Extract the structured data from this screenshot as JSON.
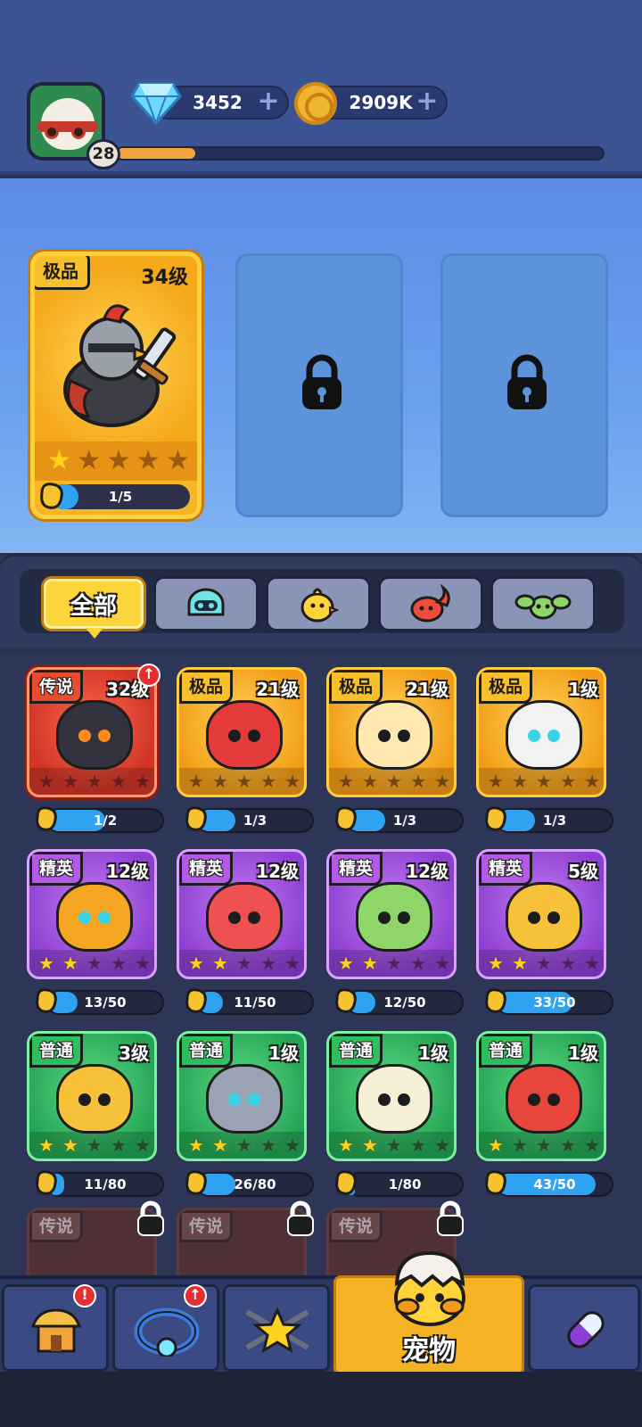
{
  "player": {
    "level": "28",
    "xp_fraction": 0.16
  },
  "currencies": {
    "gems": {
      "value": "3452",
      "plus": "+",
      "icon": "gem-icon"
    },
    "coins": {
      "value": "2909K",
      "plus": "+",
      "icon": "coin-icon"
    }
  },
  "featured": {
    "rarity": "极品",
    "level": "34级",
    "stars_on": 1,
    "stars_total": 5,
    "progress_text": "1/5",
    "progress_fraction": 0.2,
    "locked_slots": 2
  },
  "tabs": [
    {
      "label": "全部",
      "active": true,
      "icon": "all-text"
    },
    {
      "label": "",
      "active": false,
      "icon": "robot-icon"
    },
    {
      "label": "",
      "active": false,
      "icon": "chick-icon"
    },
    {
      "label": "",
      "active": false,
      "icon": "fire-blob-icon"
    },
    {
      "label": "",
      "active": false,
      "icon": "plant-icon"
    }
  ],
  "pets": [
    {
      "rarity": "传说",
      "tier": "legend",
      "level": "32级",
      "stars": 0,
      "progress": "1/2",
      "fraction": 0.5,
      "upgrade": true,
      "color": "#333340",
      "eye": "#ff8a1a"
    },
    {
      "rarity": "极品",
      "tier": "epic",
      "level": "21级",
      "stars": 0,
      "progress": "1/3",
      "fraction": 0.33,
      "upgrade": false,
      "color": "#e53b3b",
      "eye": "#1d1d1d"
    },
    {
      "rarity": "极品",
      "tier": "epic",
      "level": "21级",
      "stars": 0,
      "progress": "1/3",
      "fraction": 0.33,
      "upgrade": false,
      "color": "#ffe9b0",
      "eye": "#1d1d1d"
    },
    {
      "rarity": "极品",
      "tier": "epic",
      "level": "1级",
      "stars": 0,
      "progress": "1/3",
      "fraction": 0.33,
      "upgrade": false,
      "color": "#f2f2f2",
      "eye": "#38d3e6"
    },
    {
      "rarity": "精英",
      "tier": "elite",
      "level": "12级",
      "stars": 2,
      "progress": "13/50",
      "fraction": 0.26,
      "upgrade": false,
      "color": "#f5a623",
      "eye": "#38d3e6"
    },
    {
      "rarity": "精英",
      "tier": "elite",
      "level": "12级",
      "stars": 2,
      "progress": "11/50",
      "fraction": 0.22,
      "upgrade": false,
      "color": "#ef5151",
      "eye": "#1d1d1d"
    },
    {
      "rarity": "精英",
      "tier": "elite",
      "level": "12级",
      "stars": 2,
      "progress": "12/50",
      "fraction": 0.24,
      "upgrade": false,
      "color": "#8fd66a",
      "eye": "#1d1d1d"
    },
    {
      "rarity": "精英",
      "tier": "elite",
      "level": "5级",
      "stars": 2,
      "progress": "33/50",
      "fraction": 0.66,
      "upgrade": false,
      "color": "#f7c23a",
      "eye": "#1d1d1d"
    },
    {
      "rarity": "普通",
      "tier": "common",
      "level": "3级",
      "stars": 2,
      "progress": "11/80",
      "fraction": 0.14,
      "upgrade": false,
      "color": "#f7c23a",
      "eye": "#1d1d1d"
    },
    {
      "rarity": "普通",
      "tier": "common",
      "level": "1级",
      "stars": 2,
      "progress": "26/80",
      "fraction": 0.33,
      "upgrade": false,
      "color": "#9aa3b3",
      "eye": "#38d3e6"
    },
    {
      "rarity": "普通",
      "tier": "common",
      "level": "1级",
      "stars": 2,
      "progress": "1/80",
      "fraction": 0.02,
      "upgrade": false,
      "color": "#f5f0d6",
      "eye": "#1d1d1d"
    },
    {
      "rarity": "普通",
      "tier": "common",
      "level": "1级",
      "stars": 1,
      "progress": "43/50",
      "fraction": 0.86,
      "upgrade": false,
      "color": "#e8453c",
      "eye": "#1d1d1d"
    }
  ],
  "locked_pets": [
    {
      "rarity": "传说"
    },
    {
      "rarity": "传说"
    },
    {
      "rarity": "传说"
    }
  ],
  "nav": [
    {
      "label": "",
      "icon": "shop-icon",
      "badge": "!",
      "active": false
    },
    {
      "label": "",
      "icon": "ring-icon",
      "badge": "↑",
      "active": false
    },
    {
      "label": "",
      "icon": "star-weapons-icon",
      "badge": "",
      "active": false
    },
    {
      "label": "宠物",
      "icon": "egg-chick-icon",
      "badge": "",
      "active": true
    },
    {
      "label": "",
      "icon": "capsule-icon",
      "badge": "",
      "active": false
    }
  ],
  "colors": {
    "accent": "#fbd53a",
    "progress": "#2fa2f2",
    "badge": "#e62e2e"
  }
}
